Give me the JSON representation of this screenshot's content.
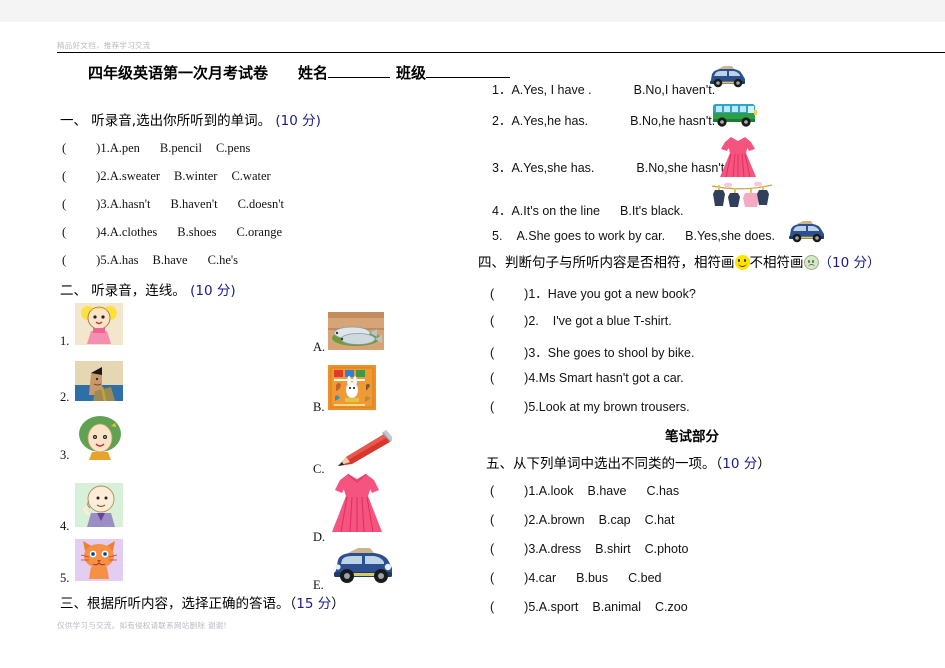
{
  "page": {
    "watermark_top": "精品好文档，推荐学习交流",
    "watermark_bottom": "仅供学习与交流。如有侵权请联系网站删除  谢谢!",
    "title": "四年级英语第一次月考试卷",
    "name_label": "姓名",
    "class_label": "班级",
    "written_part_heading": "笔试部分"
  },
  "section1": {
    "heading_text": "一、 听录音,选出你所听到的单词。",
    "points": "(10 分)",
    "items": [
      {
        "paren": "(",
        "close": ")",
        "num": "1.",
        "a": "A.pen",
        "b": "B.pencil",
        "c": "C.pens"
      },
      {
        "paren": "(",
        "close": ")",
        "num": "2.",
        "a": "A.sweater",
        "b": "B.winter",
        "c": "C.water"
      },
      {
        "paren": "(",
        "close": ")",
        "num": "3.",
        "a": "A.hasn't",
        "b": "B.haven't",
        "c": "C.doesn't"
      },
      {
        "paren": "(",
        "close": ")",
        "num": "4.",
        "a": "A.clothes",
        "b": "B.shoes",
        "c": "C.orange"
      },
      {
        "paren": "(",
        "close": ")",
        "num": "5.",
        "a": "A.has",
        "b": "B.have",
        "c": "C.he's"
      }
    ]
  },
  "section2": {
    "heading_text": "二、 听录音，连线。",
    "points": "(10 分)",
    "left_items": [
      {
        "label": "1.",
        "picture": "girl-in-pink-dress-picture"
      },
      {
        "label": "2.",
        "picture": "man-in-suit-picture"
      },
      {
        "label": "3.",
        "picture": "green-haired-woman-picture"
      },
      {
        "label": "4.",
        "picture": "bald-old-man-picture"
      },
      {
        "label": "5.",
        "picture": "orange-cat-picture"
      }
    ],
    "right_items": [
      {
        "label": "A.",
        "picture": "fish-on-plate-picture"
      },
      {
        "label": "B.",
        "picture": "animal-book-cover-picture"
      },
      {
        "label": "C.",
        "picture": "red-pencil-picture"
      },
      {
        "label": "D.",
        "picture": "pink-dress-picture"
      },
      {
        "label": "E.",
        "picture": "blue-car-picture"
      }
    ]
  },
  "section3": {
    "heading_text": "三、根据所听内容，选择正确的答语。（",
    "points": "15 分",
    "heading_tail": "）",
    "items": [
      {
        "num": "1．",
        "a": "A.Yes, I have .",
        "b": "B.No,I haven't.",
        "picture": "blue-car-picture"
      },
      {
        "num": "2．",
        "a": "A.Yes,he has.",
        "b": "B.No,he hasn't.",
        "picture": "green-bus-picture"
      },
      {
        "num": "3．",
        "a": "A.Yes,she has.",
        "b": "B.No,she hasn't.",
        "picture": "pink-dress-picture"
      },
      {
        "num": "4．",
        "a": "A.It's on the line",
        "b": "B.It's black.",
        "picture": "clothesline-picture"
      },
      {
        "num": "5.",
        "a": "A.She goes to work by car.",
        "b": "B.Yes,she does.",
        "picture": "blue-car-picture"
      }
    ]
  },
  "section4": {
    "heading_a": "四、判断句子与所听内容是否相符，相符画",
    "heading_b": "不相符画",
    "points": "（10 分）",
    "items": [
      {
        "paren": "(",
        "close": ")",
        "num": "1．",
        "text": "Have you got a new book?"
      },
      {
        "paren": "(",
        "close": ")",
        "num": "2.",
        "text": "I've got a blue T-shirt."
      },
      {
        "paren": "(",
        "close": ")",
        "num": "3．",
        "text": "She goes to shool by bike."
      },
      {
        "paren": "(",
        "close": ")",
        "num": "4.",
        "text": "Ms Smart hasn't got a car."
      },
      {
        "paren": "(",
        "close": ")",
        "num": "5.",
        "text": "Look at my brown trousers."
      }
    ]
  },
  "section5": {
    "heading_text": "五、从下列单词中选出不同类的一项。（",
    "points": "10 分",
    "heading_tail": "）",
    "items": [
      {
        "paren": "(",
        "close": ")",
        "num": "1.",
        "a": "A.look",
        "b": "B.have",
        "c": "C.has"
      },
      {
        "paren": "(",
        "close": ")",
        "num": "2.",
        "a": "A.brown",
        "b": "B.cap",
        "c": "C.hat"
      },
      {
        "paren": "(",
        "close": ")",
        "num": "3.",
        "a": "A.dress",
        "b": "B.shirt",
        "c": "C.photo"
      },
      {
        "paren": "(",
        "close": ")",
        "num": "4.",
        "a": "car",
        "b": "B.bus",
        "c": "C.bed"
      },
      {
        "paren": "(",
        "close": ")",
        "num": "5.",
        "a": "A.sport",
        "b": "B.animal",
        "c": "C.zoo"
      }
    ]
  },
  "colors": {
    "points_blue": "#1b1b8f",
    "happy_face": "#ffe400",
    "sad_face": "#d7e8c8",
    "watermark": "#b9b9c4"
  }
}
